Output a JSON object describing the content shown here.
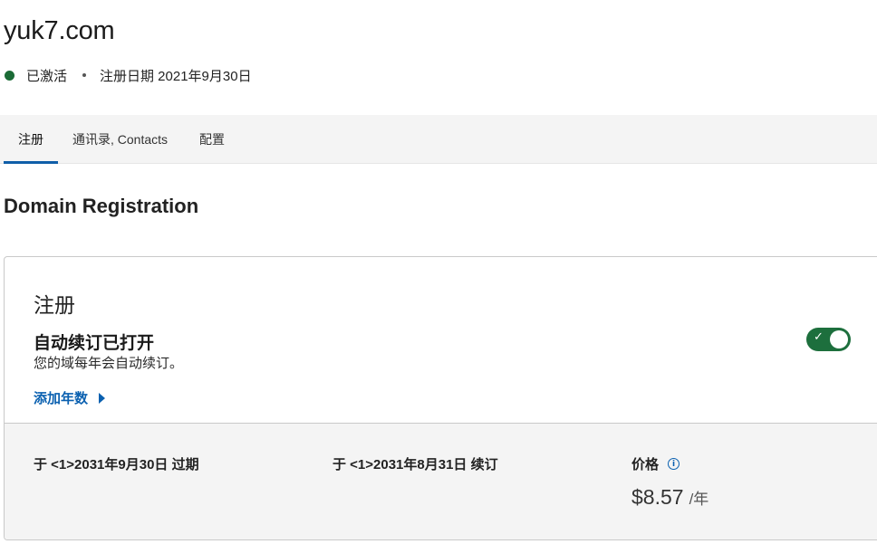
{
  "header": {
    "domain": "yuk7.com",
    "status": "已激活",
    "registered": "注册日期 2021年9月30日",
    "status_color": "#1b6b36"
  },
  "tabs": [
    {
      "label": "注册",
      "active": true
    },
    {
      "label": "通讯录, Contacts",
      "active": false
    },
    {
      "label": "配置",
      "active": false
    }
  ],
  "section": {
    "heading": "Domain Registration"
  },
  "registration": {
    "title": "注册",
    "auto_renew_title": "自动续订已打开",
    "auto_renew_desc": "您的域每年会自动续订。",
    "auto_renew_on": true,
    "add_years": "添加年数",
    "expires": "于 <1>2031年9月30日 过期",
    "renews": "于 <1>2031年8月31日 续订",
    "price_label": "价格",
    "price": "$8.57",
    "price_unit": "/年",
    "info_icon": "info-icon",
    "accent_color": "#0a60b0",
    "toggle_color": "#1d6f3d"
  }
}
